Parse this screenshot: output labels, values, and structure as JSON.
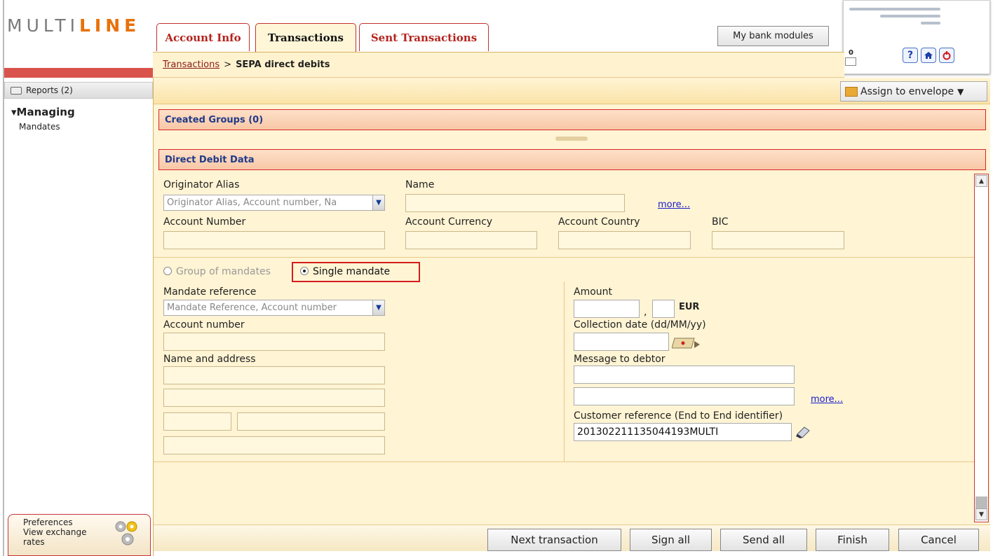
{
  "app": {
    "logo_part1": "MULTI",
    "logo_part2": "LINE",
    "logo_letter_e": "E",
    "tabs": [
      {
        "label": "Account Info"
      },
      {
        "label": "Transactions",
        "active": true
      },
      {
        "label": "Sent Transactions"
      }
    ],
    "my_bank_modules": "My bank modules",
    "envelope_count": "0",
    "header_icons": [
      "help-icon",
      "home-icon",
      "logout-icon"
    ]
  },
  "breadcrumb": {
    "link": "Transactions",
    "separator": ">",
    "current": "SEPA direct debits"
  },
  "sidebar": {
    "reports": "Reports (2)",
    "section": "Managing",
    "items": [
      {
        "label": "Mandates"
      }
    ],
    "bottom": {
      "preferences": "Preferences",
      "exchange_rates": "View exchange rates"
    }
  },
  "toolbar": {
    "assign_envelope": "Assign to envelope"
  },
  "sections": {
    "created_groups": "Created Groups (0)",
    "direct_debit": "Direct Debit Data"
  },
  "originator": {
    "alias_label": "Originator Alias",
    "alias_placeholder": "Originator Alias, Account number, Na",
    "name_label": "Name",
    "more": "more...",
    "account_number_label": "Account Number",
    "account_currency_label": "Account Currency",
    "account_country_label": "Account Country",
    "bic_label": "BIC"
  },
  "mandate_type": {
    "group": "Group of mandates",
    "single": "Single mandate",
    "selected": "single"
  },
  "mandate": {
    "reference_label": "Mandate reference",
    "reference_placeholder": "Mandate Reference, Account number",
    "account_number_label": "Account number",
    "name_address_label": "Name and address"
  },
  "payment": {
    "amount_label": "Amount",
    "decimal_sep": ",",
    "currency": "EUR",
    "collection_date_label": "Collection date (dd/MM/yy)",
    "message_label": "Message to debtor",
    "more": "more...",
    "customer_ref_label": "Customer reference (End to End identifier)",
    "customer_ref_value": "201302211135044193MULTI"
  },
  "footer": {
    "next": "Next transaction",
    "sign_all": "Sign all",
    "send_all": "Send all",
    "finish": "Finish",
    "cancel": "Cancel"
  },
  "colors": {
    "accent": "#b3241f",
    "panel": "#fff4d4",
    "link": "#1a1acc"
  }
}
